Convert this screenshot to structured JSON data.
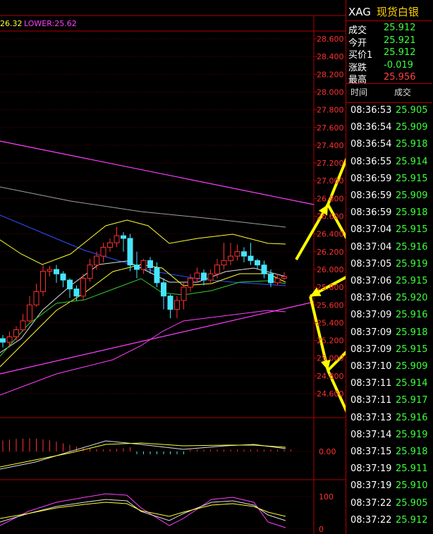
{
  "indicator": {
    "mid_val": "26.32",
    "lower_label": "LOWER:25.62"
  },
  "price_axis": [
    "28.600",
    "28.400",
    "28.200",
    "28.000",
    "27.800",
    "27.600",
    "27.400",
    "27.200",
    "27.000",
    "26.800",
    "26.600",
    "26.400",
    "26.200",
    "26.000",
    "25.800",
    "25.600",
    "25.400",
    "25.200",
    "25.000",
    "24.800",
    "24.600"
  ],
  "macd_axis": [
    "0.00"
  ],
  "kdj_axis": [
    "100",
    "0"
  ],
  "header": {
    "code": "XAG",
    "name": "现货白银"
  },
  "quote": [
    {
      "label": "成交",
      "value": "25.912",
      "color": "#3cff3c"
    },
    {
      "label": "今开",
      "value": "25.921",
      "color": "#3cff3c"
    },
    {
      "label": "买价1",
      "value": "25.912",
      "color": "#3cff3c"
    },
    {
      "label": "涨跌",
      "value": "-0.019",
      "color": "#3cff3c"
    },
    {
      "label": "最高",
      "value": "25.956",
      "color": "#ff4040"
    }
  ],
  "ticks_header": {
    "time": "时间",
    "price": "成交"
  },
  "ticks": [
    {
      "time": "08:36:53",
      "price": "25.905"
    },
    {
      "time": "08:36:54",
      "price": "25.909"
    },
    {
      "time": "08:36:54",
      "price": "25.918"
    },
    {
      "time": "08:36:55",
      "price": "25.914"
    },
    {
      "time": "08:36:59",
      "price": "25.915"
    },
    {
      "time": "08:36:59",
      "price": "25.909"
    },
    {
      "time": "08:36:59",
      "price": "25.918"
    },
    {
      "time": "08:37:04",
      "price": "25.915"
    },
    {
      "time": "08:37:04",
      "price": "25.916"
    },
    {
      "time": "08:37:05",
      "price": "25.919"
    },
    {
      "time": "08:37:06",
      "price": "25.915"
    },
    {
      "time": "08:37:06",
      "price": "25.920"
    },
    {
      "time": "08:37:09",
      "price": "25.916"
    },
    {
      "time": "08:37:09",
      "price": "25.918"
    },
    {
      "time": "08:37:09",
      "price": "25.915"
    },
    {
      "time": "08:37:10",
      "price": "25.909"
    },
    {
      "time": "08:37:11",
      "price": "25.914"
    },
    {
      "time": "08:37:11",
      "price": "25.917"
    },
    {
      "time": "08:37:13",
      "price": "25.916"
    },
    {
      "time": "08:37:14",
      "price": "25.919"
    },
    {
      "time": "08:37:15",
      "price": "25.918"
    },
    {
      "time": "08:37:19",
      "price": "25.911"
    },
    {
      "time": "08:37:19",
      "price": "25.910"
    },
    {
      "time": "08:37:22",
      "price": "25.905"
    },
    {
      "time": "08:37:22",
      "price": "25.912"
    }
  ],
  "candles": [
    {
      "o": 25.22,
      "c": 25.18,
      "h": 25.26,
      "l": 25.12
    },
    {
      "o": 25.18,
      "c": 25.24,
      "h": 25.3,
      "l": 25.12
    },
    {
      "o": 25.24,
      "c": 25.32,
      "h": 25.36,
      "l": 25.2
    },
    {
      "o": 25.32,
      "c": 25.42,
      "h": 25.5,
      "l": 25.3
    },
    {
      "o": 25.42,
      "c": 25.6,
      "h": 25.7,
      "l": 25.4
    },
    {
      "o": 25.6,
      "c": 25.75,
      "h": 25.84,
      "l": 25.58
    },
    {
      "o": 25.75,
      "c": 25.98,
      "h": 26.05,
      "l": 25.7
    },
    {
      "o": 25.98,
      "c": 26.0,
      "h": 26.04,
      "l": 25.92
    },
    {
      "o": 26.0,
      "c": 25.95,
      "h": 26.05,
      "l": 25.85
    },
    {
      "o": 25.95,
      "c": 25.88,
      "h": 25.98,
      "l": 25.8
    },
    {
      "o": 25.88,
      "c": 25.78,
      "h": 25.9,
      "l": 25.68
    },
    {
      "o": 25.78,
      "c": 25.7,
      "h": 25.82,
      "l": 25.65
    },
    {
      "o": 25.7,
      "c": 25.9,
      "h": 25.95,
      "l": 25.66
    },
    {
      "o": 25.9,
      "c": 26.05,
      "h": 26.12,
      "l": 25.86
    },
    {
      "o": 26.05,
      "c": 26.15,
      "h": 26.2,
      "l": 26.0
    },
    {
      "o": 26.15,
      "c": 26.25,
      "h": 26.3,
      "l": 26.08
    },
    {
      "o": 26.25,
      "c": 26.3,
      "h": 26.35,
      "l": 26.2
    },
    {
      "o": 26.3,
      "c": 26.38,
      "h": 26.48,
      "l": 26.25
    },
    {
      "o": 26.38,
      "c": 26.35,
      "h": 26.42,
      "l": 26.2
    },
    {
      "o": 26.35,
      "c": 26.05,
      "h": 26.4,
      "l": 25.98
    },
    {
      "o": 26.05,
      "c": 26.0,
      "h": 26.2,
      "l": 25.9
    },
    {
      "o": 26.0,
      "c": 26.1,
      "h": 26.12,
      "l": 25.95
    },
    {
      "o": 26.1,
      "c": 26.02,
      "h": 26.14,
      "l": 25.95
    },
    {
      "o": 26.02,
      "c": 25.85,
      "h": 26.08,
      "l": 25.8
    },
    {
      "o": 25.85,
      "c": 25.7,
      "h": 25.9,
      "l": 25.55
    },
    {
      "o": 25.7,
      "c": 25.55,
      "h": 25.72,
      "l": 25.45
    },
    {
      "o": 25.55,
      "c": 25.65,
      "h": 25.7,
      "l": 25.45
    },
    {
      "o": 25.65,
      "c": 25.8,
      "h": 25.85,
      "l": 25.55
    },
    {
      "o": 25.8,
      "c": 25.9,
      "h": 25.95,
      "l": 25.75
    },
    {
      "o": 25.9,
      "c": 25.96,
      "h": 26.02,
      "l": 25.85
    },
    {
      "o": 25.96,
      "c": 25.88,
      "h": 26.0,
      "l": 25.82
    },
    {
      "o": 25.88,
      "c": 25.95,
      "h": 26.0,
      "l": 25.85
    },
    {
      "o": 25.95,
      "c": 26.05,
      "h": 26.12,
      "l": 25.9
    },
    {
      "o": 26.05,
      "c": 26.1,
      "h": 26.3,
      "l": 26.0
    },
    {
      "o": 26.1,
      "c": 26.15,
      "h": 26.3,
      "l": 26.05
    },
    {
      "o": 26.15,
      "c": 26.2,
      "h": 26.28,
      "l": 26.1
    },
    {
      "o": 26.2,
      "c": 26.15,
      "h": 26.25,
      "l": 26.08
    },
    {
      "o": 26.15,
      "c": 26.1,
      "h": 26.3,
      "l": 26.05
    },
    {
      "o": 26.1,
      "c": 26.05,
      "h": 26.12,
      "l": 26.0
    },
    {
      "o": 26.05,
      "c": 25.95,
      "h": 26.1,
      "l": 25.9
    },
    {
      "o": 25.95,
      "c": 25.85,
      "h": 26.0,
      "l": 25.8
    },
    {
      "o": 25.85,
      "c": 25.9,
      "h": 25.95,
      "l": 25.82
    },
    {
      "o": 25.9,
      "c": 25.92,
      "h": 25.97,
      "l": 25.88
    }
  ],
  "colors": {
    "up": "#ff3030",
    "down": "#44e6ff",
    "grid": "#b00000",
    "axis_text": "#ff3030",
    "ma_yellow": "#ffff30",
    "ma_white": "#e0e0e0",
    "ma_green": "#30d030",
    "ma_blue": "#3050ff",
    "ma_magenta": "#ff40ff",
    "arrow": "#ffff00"
  }
}
